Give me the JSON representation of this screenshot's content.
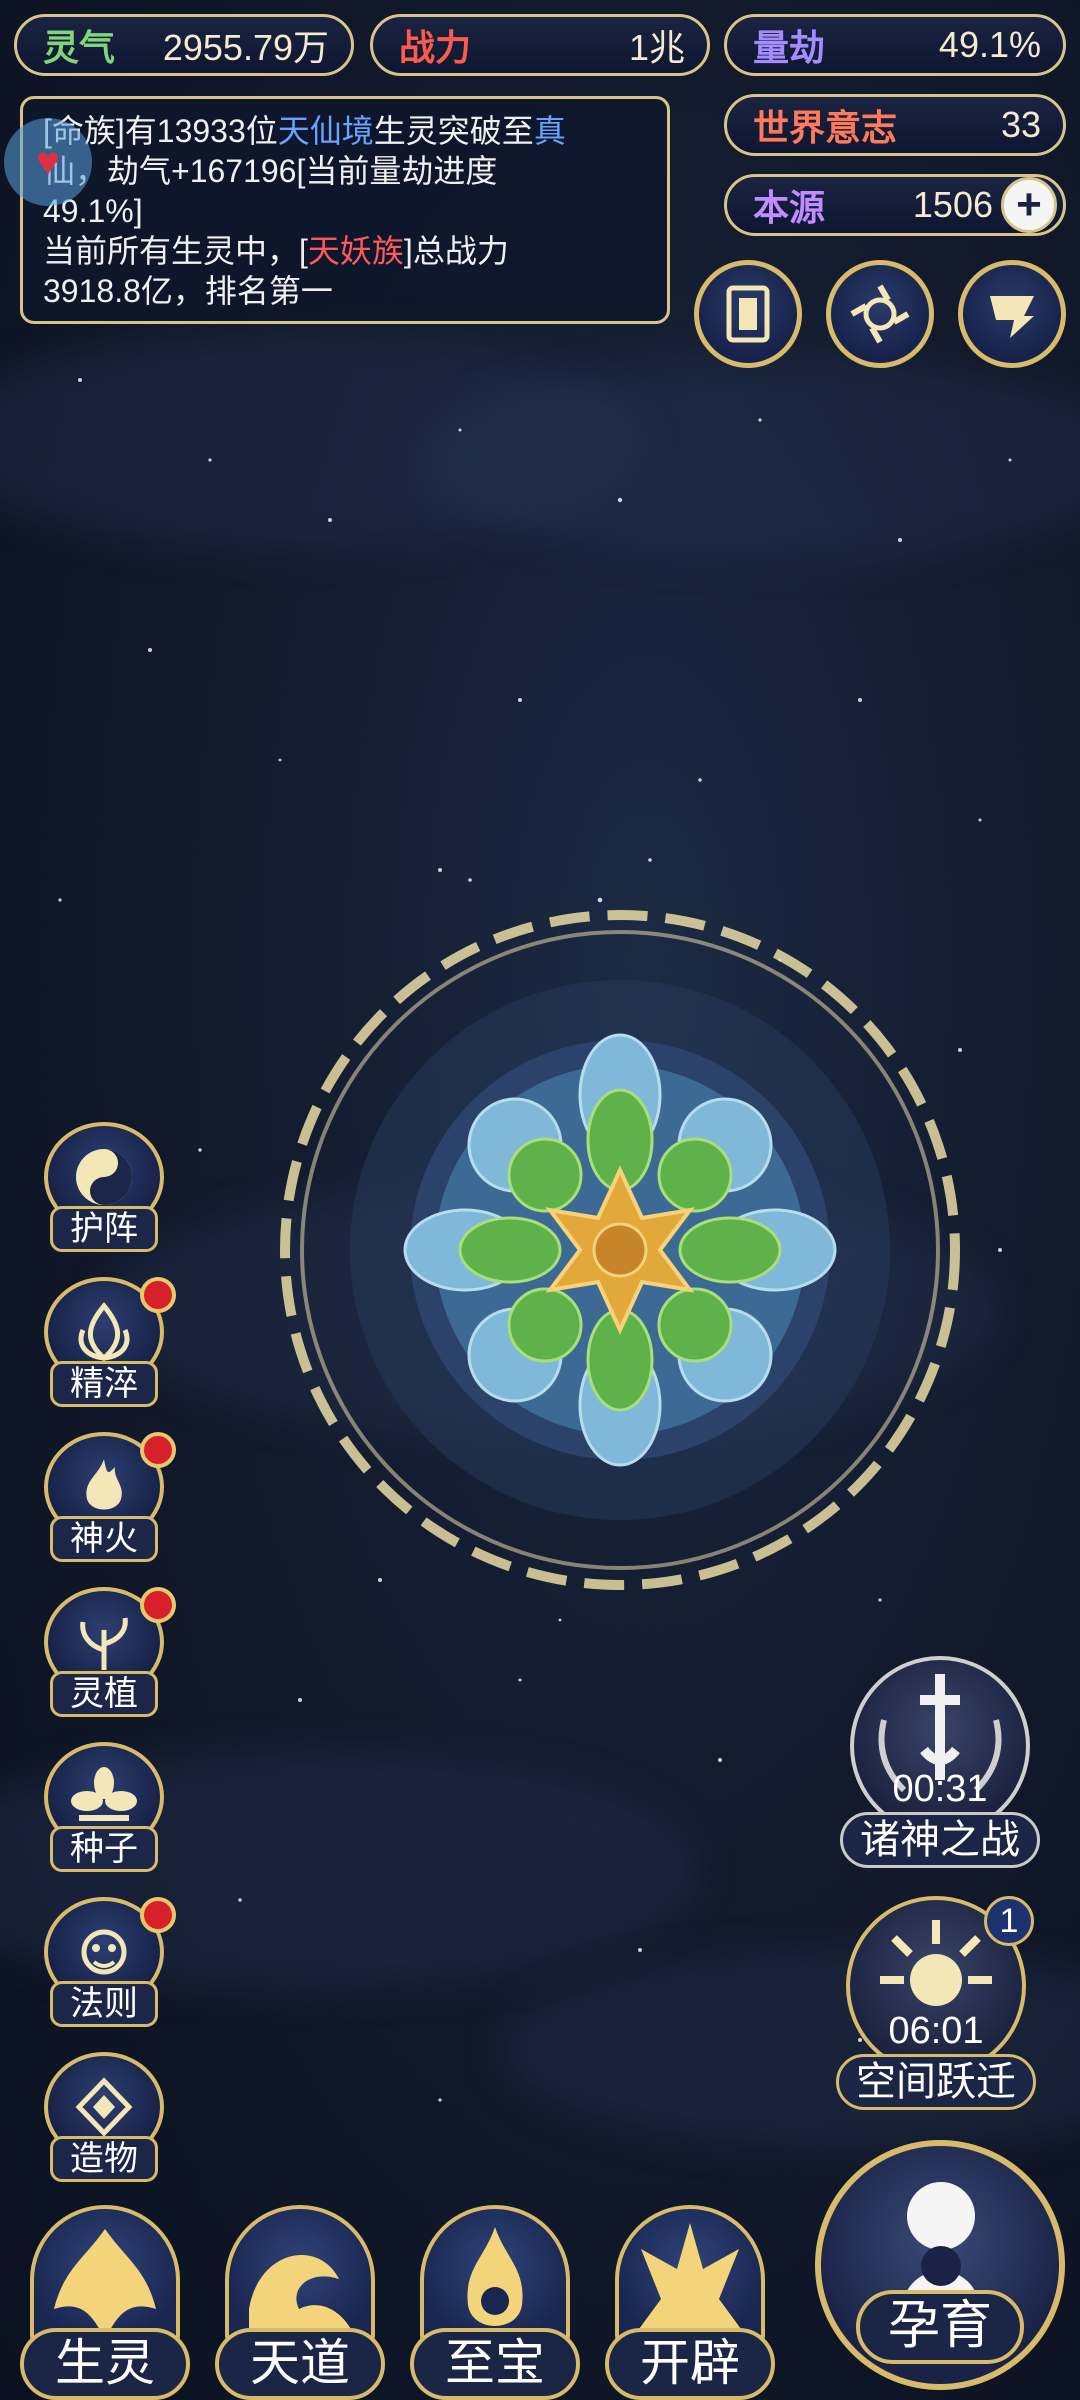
{
  "resources": {
    "lingqi": {
      "label": "灵气",
      "value": "2955.79万"
    },
    "zhanli": {
      "label": "战力",
      "value": "1兆"
    },
    "liangjie": {
      "label": "量劫",
      "value": "49.1%"
    },
    "world_will": {
      "label": "世界意志",
      "value": "33"
    },
    "benyuan": {
      "label": "本源",
      "value": "1506"
    }
  },
  "message": {
    "line1_prefix": "[命族]有13933位",
    "line1_realm": "天仙境",
    "line1_mid": "生灵突破至",
    "line1_realm2": "真",
    "line2": "仙，劫气+167196[当前量劫进度",
    "line3": "49.1%]",
    "line4_prefix": "当前所有生灵中，[",
    "line4_race": "天妖族",
    "line4_suffix": "]总战力",
    "line5": "3918.8亿，排名第一"
  },
  "side_menu": [
    {
      "label": "护阵",
      "badge": false,
      "icon": "yin-yang-icon"
    },
    {
      "label": "精淬",
      "badge": true,
      "icon": "flame-lotus-icon"
    },
    {
      "label": "神火",
      "badge": true,
      "icon": "fire-icon"
    },
    {
      "label": "灵植",
      "badge": true,
      "icon": "plant-icon"
    },
    {
      "label": "种子",
      "badge": false,
      "icon": "seed-flower-icon"
    },
    {
      "label": "法则",
      "badge": true,
      "icon": "dragon-icon"
    },
    {
      "label": "造物",
      "badge": false,
      "icon": "diamond-rune-icon"
    }
  ],
  "events": {
    "gods_war": {
      "label": "诸神之战",
      "timer": "00:31"
    },
    "space_jump": {
      "label": "空间跃迁",
      "timer": "06:01",
      "badge": "1"
    }
  },
  "bottom_nav": [
    "生灵",
    "天道",
    "至宝",
    "开辟"
  ],
  "main_action": "孕育",
  "colors": {
    "gold": "#d7c48a",
    "blue_text": "#6aa2ff",
    "red_text": "#ff5a5a",
    "badge_red": "#d7202a"
  }
}
